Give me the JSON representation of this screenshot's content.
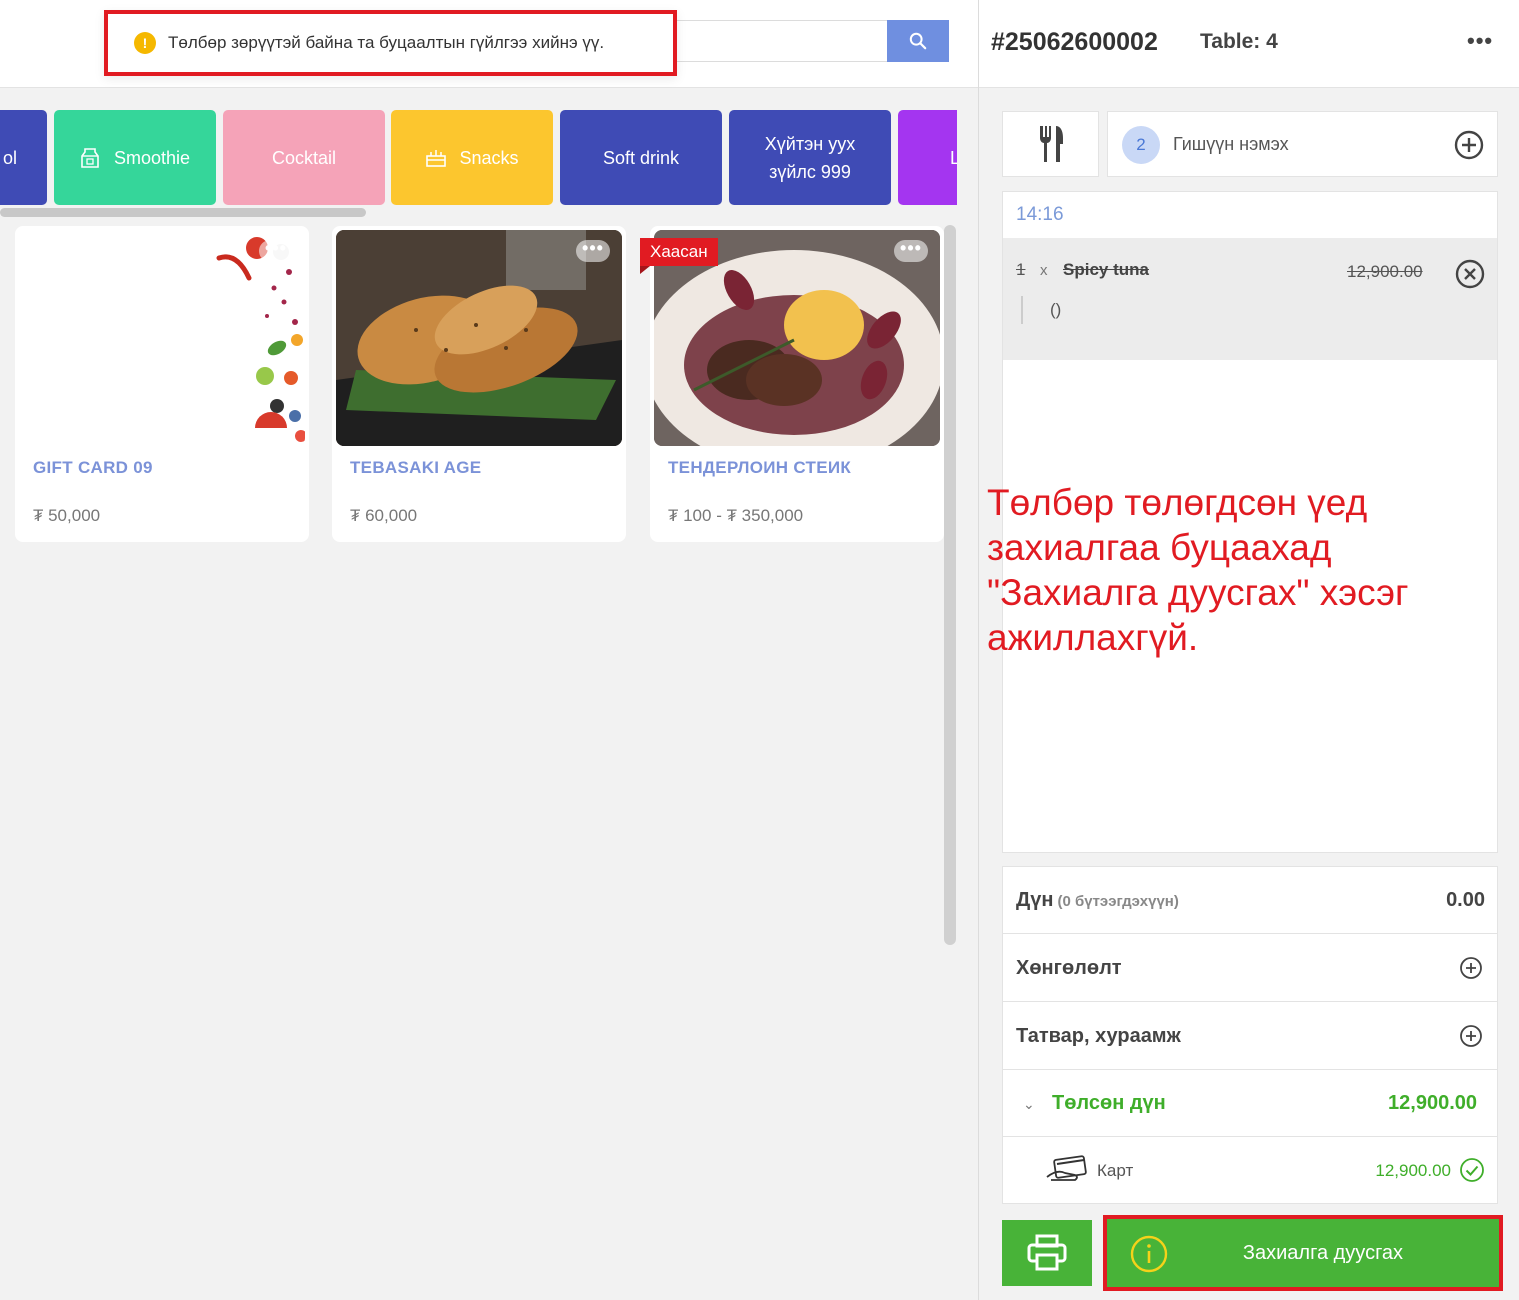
{
  "toast": {
    "message": "Төлбөр зөрүүтэй байна та буцаалтын гүйлгээ хийнэ үү."
  },
  "search": {
    "placeholder": ""
  },
  "categories": [
    {
      "label": "ol",
      "color": "#3f4bb5"
    },
    {
      "label": "Smoothie",
      "color": "#35d69a",
      "icon": "milk-carton-icon"
    },
    {
      "label": "Cocktail",
      "color": "#f5a3b8"
    },
    {
      "label": "Snacks",
      "color": "#fcc62e",
      "icon": "cake-icon"
    },
    {
      "label": "Soft drink",
      "color": "#3f4bb5"
    },
    {
      "label": "Хүйтэн уух\nзүйлс 999",
      "color": "#3f4bb5"
    },
    {
      "label": "L",
      "color": "#a435f0"
    }
  ],
  "products": [
    {
      "name": "GIFT CARD 09",
      "price": "₮ 50,000"
    },
    {
      "name": "TEBASAKI AGE",
      "price": "₮ 60,000"
    },
    {
      "name": "ТЕНДЕРЛОИН СТЕИК",
      "price": "₮ 100 - ₮ 350,000",
      "badge": "Хаасан"
    }
  ],
  "order": {
    "number": "#25062600002",
    "table": "Table: 4",
    "guest_count": "2",
    "guest_add_label": "Гишүүн нэмэх",
    "time": "14:16",
    "items": [
      {
        "qty": "1",
        "x": "x",
        "name": "Spicy tuna",
        "price": "12,900.00",
        "modifier": "()"
      }
    ]
  },
  "annotation": "Төлбөр төлөгдсөн үед захиалгаа буцаахад \"Захиалга дуусгах\" хэсэг ажиллахгүй.",
  "summary": {
    "amount_label": "Дүн",
    "amount_sub": "(0 бүтээгдэхүүн)",
    "amount_value": "0.00",
    "discount_label": "Хөнгөлөлт",
    "tax_label": "Татвар, хураамж",
    "paid_label": "Төлсөн дүн",
    "paid_value": "12,900.00",
    "card_label": "Карт",
    "card_value": "12,900.00"
  },
  "actions": {
    "finish_label": "Захиалга дуусгах"
  },
  "colors": {
    "accent_green": "#48b338",
    "alert_red": "#e11b22",
    "link_blue": "#7b92d8"
  }
}
